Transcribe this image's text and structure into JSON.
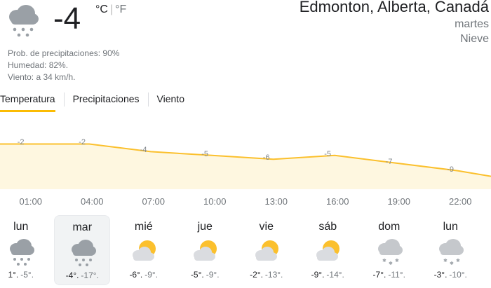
{
  "current": {
    "icon": "snow-cloud-icon",
    "temperature": "-4",
    "unit_c": "°C",
    "unit_sep": "|",
    "unit_f": "°F",
    "precip": "Prob. de precipitaciones: 90%",
    "humidity": "Humedad: 82%.",
    "wind": "Viento: a 34 km/h."
  },
  "location": {
    "city": "Edmonton, Alberta, Canadá",
    "day": "martes",
    "condition": "Nieve"
  },
  "tabs": [
    {
      "label": "Temperatura",
      "active": true
    },
    {
      "label": "Precipitaciones",
      "active": false
    },
    {
      "label": "Viento",
      "active": false
    }
  ],
  "chart_data": {
    "type": "area",
    "x": [
      "01:00",
      "04:00",
      "07:00",
      "10:00",
      "13:00",
      "16:00",
      "19:00",
      "22:00"
    ],
    "values": [
      -2,
      -2,
      -4,
      -5,
      -6,
      -5,
      -7,
      -9
    ],
    "labels": [
      "-2",
      "-2",
      "-4",
      "-5",
      "-6",
      "-5",
      "-7",
      "-9"
    ],
    "fill_color": "#fef7e0",
    "line_color": "#fbc02d"
  },
  "days": [
    {
      "name": "lun",
      "icon": "snow-icon",
      "hi": "1°.",
      "lo": "-5°.",
      "selected": false
    },
    {
      "name": "mar",
      "icon": "snow-icon",
      "hi": "-4°.",
      "lo": "-17°.",
      "selected": true
    },
    {
      "name": "mié",
      "icon": "partly-cloudy-icon",
      "hi": "-6°.",
      "lo": "-9°.",
      "selected": false
    },
    {
      "name": "jue",
      "icon": "partly-cloudy-icon",
      "hi": "-5°.",
      "lo": "-9°.",
      "selected": false
    },
    {
      "name": "vie",
      "icon": "partly-cloudy-icon",
      "hi": "-2°.",
      "lo": "-13°.",
      "selected": false
    },
    {
      "name": "sáb",
      "icon": "partly-cloudy-icon",
      "hi": "-9°.",
      "lo": "-14°.",
      "selected": false
    },
    {
      "name": "dom",
      "icon": "light-snow-icon",
      "hi": "-7°.",
      "lo": "-11°.",
      "selected": false
    },
    {
      "name": "lun",
      "icon": "light-snow-icon",
      "hi": "-3°.",
      "lo": "-10°.",
      "selected": false
    }
  ]
}
